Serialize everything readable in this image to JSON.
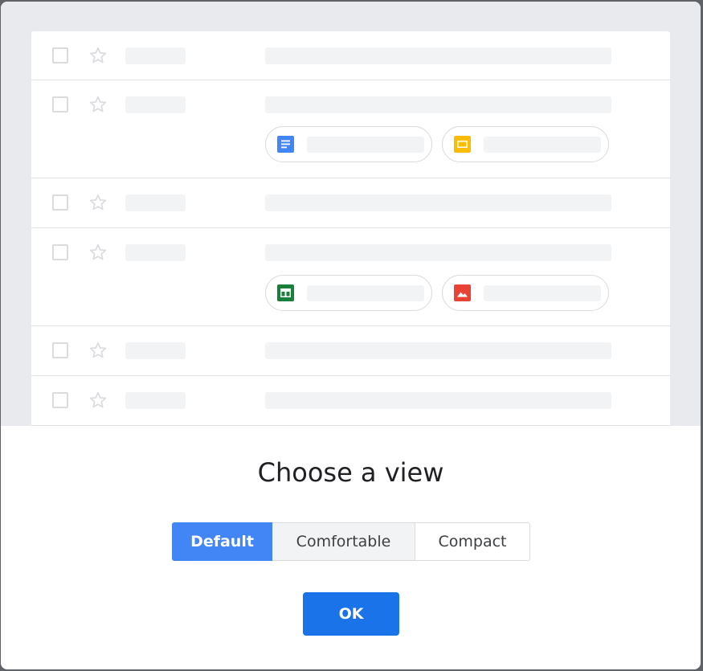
{
  "dialog": {
    "title": "Choose a view",
    "options": [
      "Default",
      "Comfortable",
      "Compact"
    ],
    "selected_option": "Default",
    "ok_label": "OK"
  },
  "preview": {
    "rows": [
      {
        "attachments": []
      },
      {
        "attachments": [
          "docs-file-icon",
          "slides-file-icon"
        ]
      },
      {
        "attachments": []
      },
      {
        "attachments": [
          "sheets-file-icon",
          "image-file-icon"
        ]
      },
      {
        "attachments": []
      },
      {
        "attachments": []
      }
    ]
  },
  "colors": {
    "selected_segment": "#4285f4",
    "ok_button": "#1a73e8",
    "docs": "#4285f4",
    "slides": "#fbbc04",
    "sheets": "#188038",
    "image": "#ea4335",
    "placeholder": "#f1f3f4",
    "preview_background": "#e8eaed"
  }
}
